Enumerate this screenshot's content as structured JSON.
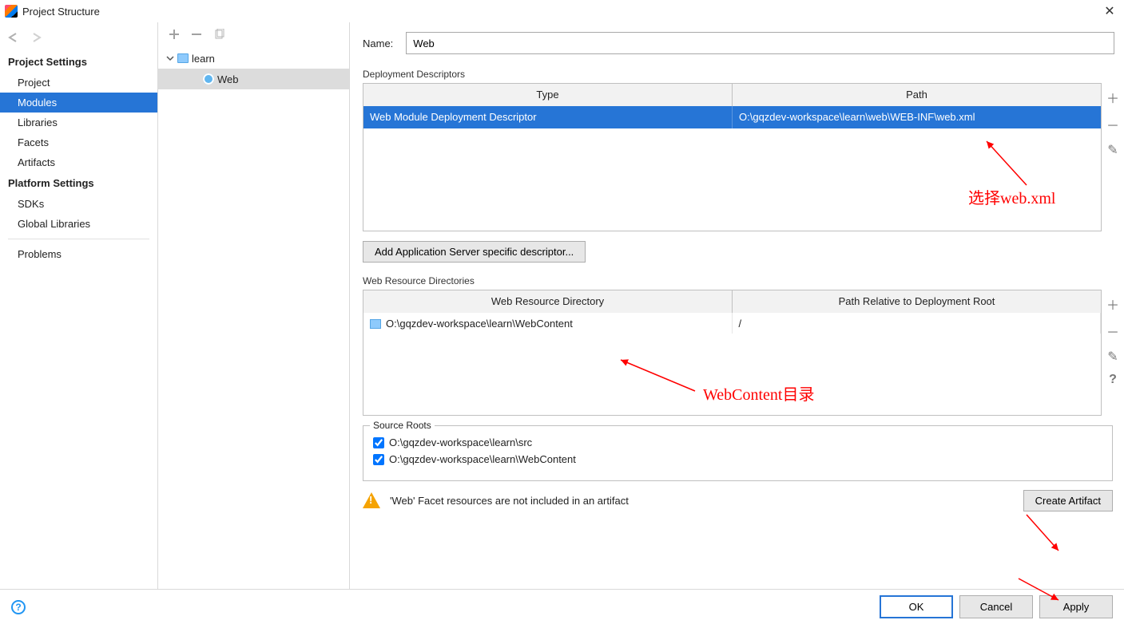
{
  "window": {
    "title": "Project Structure"
  },
  "sidebar": {
    "projectSettings": "Project Settings",
    "items1": [
      "Project",
      "Modules",
      "Libraries",
      "Facets",
      "Artifacts"
    ],
    "platformSettings": "Platform Settings",
    "items2": [
      "SDKs",
      "Global Libraries"
    ],
    "items3": [
      "Problems"
    ],
    "selected": "Modules"
  },
  "tree": {
    "root": "learn",
    "child": "Web"
  },
  "name": {
    "label": "Name:",
    "value": "Web"
  },
  "dd": {
    "title": "Deployment Descriptors",
    "cols": [
      "Type",
      "Path"
    ],
    "row": {
      "type": "Web Module Deployment Descriptor",
      "path": "O:\\gqzdev-workspace\\learn\\web\\WEB-INF\\web.xml"
    },
    "addBtn": "Add Application Server specific descriptor..."
  },
  "wr": {
    "title": "Web Resource Directories",
    "cols": [
      "Web Resource Directory",
      "Path Relative to Deployment Root"
    ],
    "row": {
      "dir": "O:\\gqzdev-workspace\\learn\\WebContent",
      "rel": "/"
    }
  },
  "sr": {
    "title": "Source Roots",
    "items": [
      "O:\\gqzdev-workspace\\learn\\src",
      "O:\\gqzdev-workspace\\learn\\WebContent"
    ]
  },
  "warning": "'Web' Facet resources are not included in an artifact",
  "createBtn": "Create Artifact",
  "footer": {
    "ok": "OK",
    "cancel": "Cancel",
    "apply": "Apply"
  },
  "annotations": {
    "a1": "选择web.xml",
    "a2": "WebContent目录"
  }
}
